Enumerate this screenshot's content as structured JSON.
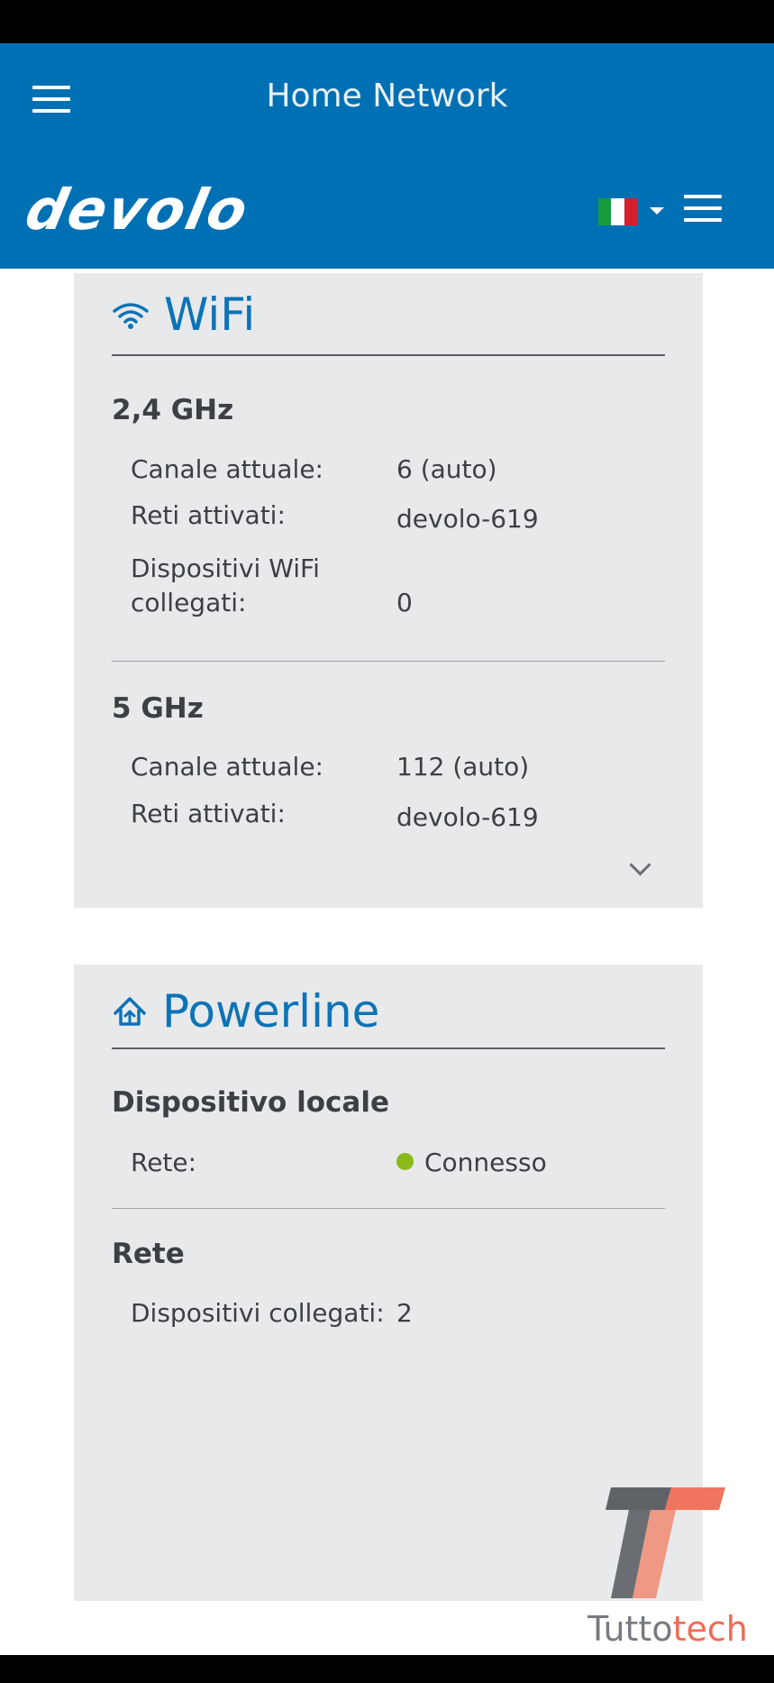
{
  "app_bar": {
    "title": "Home Network"
  },
  "site_header": {
    "logo_text": "devolo",
    "language_flag": "flag-it",
    "colors": {
      "brand_blue": "#0070b4"
    }
  },
  "wifi_card": {
    "title": "WiFi",
    "icon": "wifi-icon",
    "band_24": {
      "title": "2,4 GHz",
      "channel_label": "Canale attuale:",
      "channel_value": "6 (auto)",
      "networks_label": "Reti attivati:",
      "networks_value": "devolo-619",
      "devices_label_line1": "Dispositivi WiFi",
      "devices_label_line2": "collegati:",
      "devices_value": "0"
    },
    "band_5": {
      "title": "5 GHz",
      "channel_label": "Canale attuale:",
      "channel_value": "112 (auto)",
      "networks_label": "Reti attivati:",
      "networks_value": "devolo-619"
    },
    "expand_icon": "chevron-down-icon"
  },
  "powerline_card": {
    "title": "Powerline",
    "icon": "home-icon",
    "local_device": {
      "title": "Dispositivo locale",
      "network_label": "Rete:",
      "network_status": "Connesso",
      "status_color": "#8ab918"
    },
    "network": {
      "title": "Rete",
      "connected_label": "Dispositivi collegati:",
      "connected_value": "2"
    }
  },
  "watermark": {
    "text_a": "Tutto",
    "text_b": "tech"
  }
}
